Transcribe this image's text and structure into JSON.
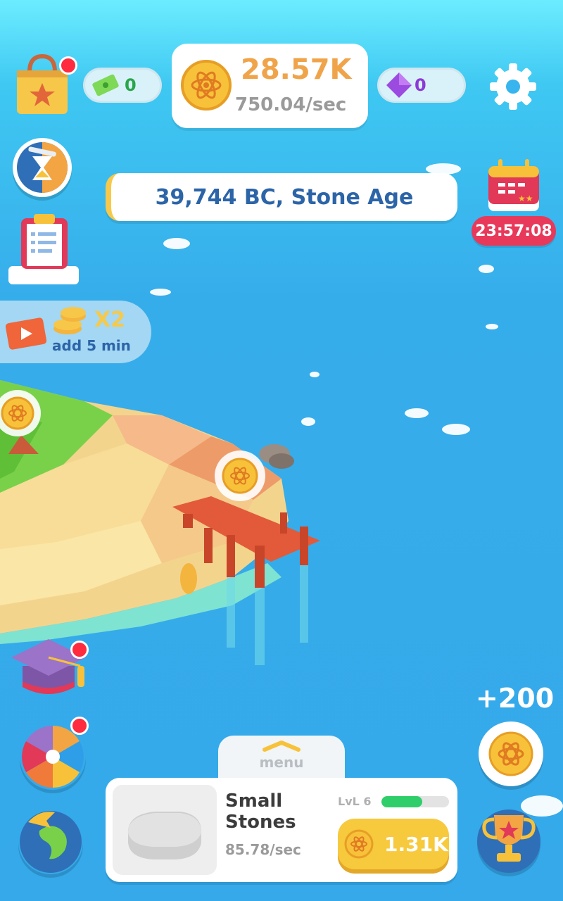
{
  "resources": {
    "tickets": "0",
    "coins": "28.57K",
    "coins_rate": "750.04/sec",
    "gems": "0"
  },
  "era": "39,744 BC, Stone Age",
  "event_timer": "23:57:08",
  "boost": {
    "multiplier": "X2",
    "label": "add 5 min"
  },
  "bonus": "+200",
  "menu_label": "menu",
  "building": {
    "name_line1": "Small",
    "name_line2": "Stones",
    "rate": "85.78/sec",
    "level": "LvL 6",
    "level_progress": 0.6,
    "price": "1.31K"
  },
  "icons": [
    "shop-bag-icon",
    "ticket-icon",
    "coin-icon",
    "gem-icon",
    "gear-icon",
    "hourglass-icon",
    "calendar-icon",
    "clipboard-icon",
    "video-icon",
    "graduation-cap-icon",
    "color-wheel-icon",
    "globe-icon",
    "trophy-icon"
  ],
  "colors": {
    "coin": "#f0a44a",
    "era_text": "#2c64a8",
    "timer": "#e8395a",
    "progress": "#2fce6a",
    "buy_button": "#f7c93c"
  }
}
